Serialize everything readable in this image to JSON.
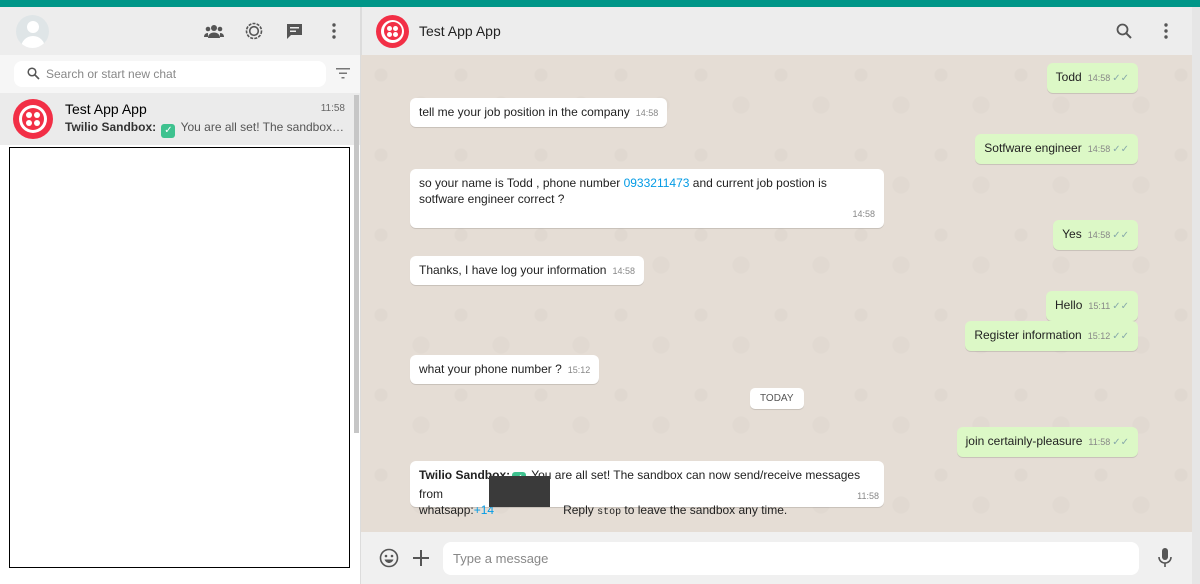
{
  "sidebar": {
    "search_placeholder": "Search or start new chat",
    "chat": {
      "name": "Test App App",
      "time": "11:58",
      "preview_sender": "Twilio Sandbox:",
      "preview_text": "You are all set! The sandbox can now send/receive messages from whatsapp"
    }
  },
  "conversation": {
    "title": "Test App App",
    "date_divider": "TODAY",
    "messages": [
      {
        "text": "Todd",
        "time": "14:58",
        "direction": "out"
      },
      {
        "text": "tell me your job position in the company",
        "time": "14:58",
        "direction": "in"
      },
      {
        "text": "Sotfware engineer",
        "time": "14:58",
        "direction": "out"
      },
      {
        "text_before": "so your name is Todd  , phone number ",
        "phone": "0933211473",
        "text_after": " and current job postion is sotfware engineer correct ?",
        "time": "14:58",
        "direction": "in"
      },
      {
        "text": "Yes",
        "time": "14:58",
        "direction": "out"
      },
      {
        "text": "Thanks, I have log your information",
        "time": "14:58",
        "direction": "in"
      },
      {
        "text": "Hello",
        "time": "15:11",
        "direction": "out"
      },
      {
        "text": "Register information",
        "time": "15:12",
        "direction": "out"
      },
      {
        "text": "what your phone number ?",
        "time": "15:12",
        "direction": "in"
      },
      {
        "text": "join certainly-pleasure",
        "time": "11:58",
        "direction": "out"
      },
      {
        "sender": "Twilio Sandbox:",
        "text": " You are all set! The sandbox can now send/receive messages from",
        "line2_prefix": "whatsapp:",
        "line2_link": "+14",
        "line2_reply": "Reply ",
        "line2_code": "stop",
        "line2_suffix": " to leave the sandbox any time.",
        "time": "11:58",
        "direction": "in"
      }
    ]
  },
  "composer": {
    "placeholder": "Type a message"
  },
  "colors": {
    "brand_teal": "#009688",
    "twilio_red": "#f22f46",
    "outgoing_bubble": "#dcf8c6",
    "link_blue": "#039be5"
  },
  "icons": [
    "community-icon",
    "status-icon",
    "new-chat-icon",
    "menu-icon",
    "search-icon",
    "filter-icon",
    "emoji-icon",
    "attach-icon",
    "microphone-icon",
    "read-receipt-icon"
  ]
}
